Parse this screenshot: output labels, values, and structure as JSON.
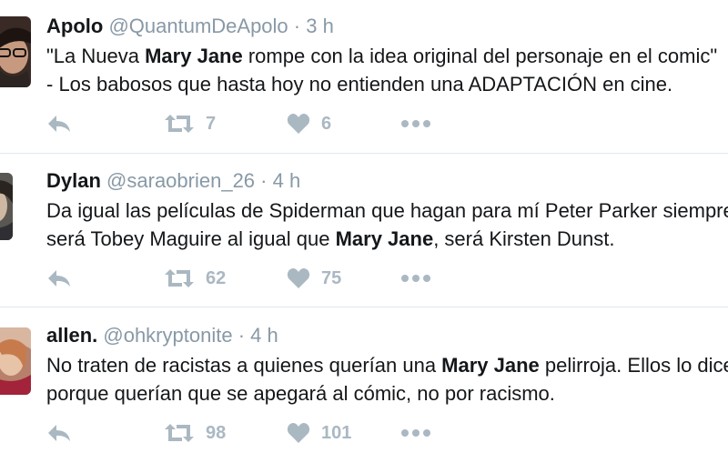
{
  "tweets": [
    {
      "name": "Apolo",
      "handle": "@QuantumDeApolo",
      "time": "3 h",
      "lines": [
        [
          "\"La Nueva ",
          "Mary Jane",
          " rompe con la idea original del personaje en el comic\""
        ],
        [
          " - Los babosos que hasta hoy no entienden una ADAPTACIÓN en cine.",
          "",
          ""
        ]
      ],
      "retweets": "7",
      "likes": "6"
    },
    {
      "name": "Dylan",
      "handle": "@saraobrien_26",
      "time": "4 h",
      "lines": [
        [
          "Da igual las películas de Spiderman que hagan para mí Peter Parker siempre",
          "",
          ""
        ],
        [
          "será Tobey Maguire al igual que ",
          "Mary Jane",
          ", será Kirsten Dunst."
        ]
      ],
      "retweets": "62",
      "likes": "75"
    },
    {
      "name": "allen.",
      "handle": "@ohkryptonite",
      "time": "4 h",
      "lines": [
        [
          "No traten de racistas a quienes querían una ",
          "Mary Jane",
          " pelirroja. Ellos lo dicen"
        ],
        [
          "porque querían que se apegará al cómic, no por racismo.",
          "",
          ""
        ]
      ],
      "retweets": "98",
      "likes": "101"
    }
  ],
  "icons": {
    "reply": "reply-icon",
    "retweet": "retweet-icon",
    "like": "heart-icon",
    "more": "more-dots-icon"
  },
  "colors": {
    "text": "#14171a",
    "muted": "#8899a6",
    "icon": "#aab8c2",
    "divider": "#e1e8ed"
  }
}
